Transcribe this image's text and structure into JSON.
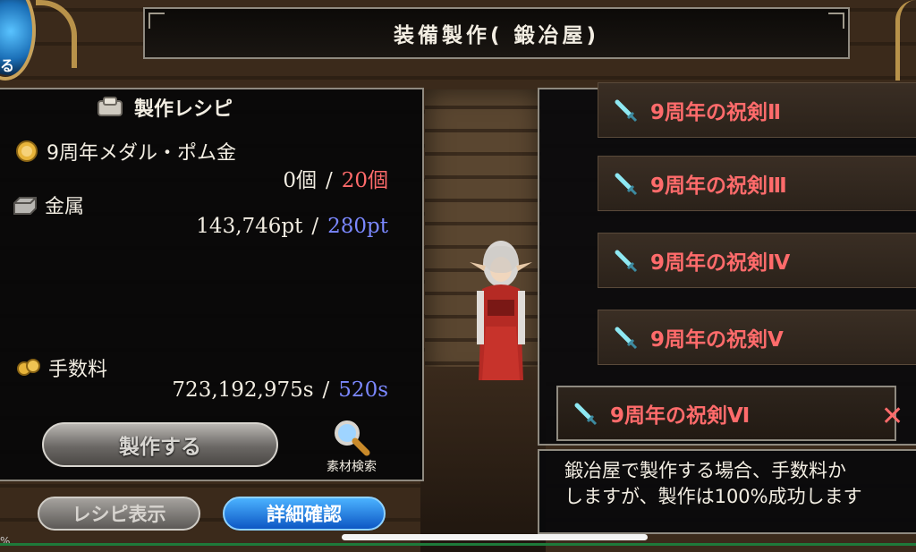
{
  "header": {
    "title": "装備製作( 鍛冶屋)"
  },
  "orb": {
    "text": "る"
  },
  "recipe": {
    "heading": "製作レシピ",
    "materials": [
      {
        "name": "9周年メダル・ポム金",
        "have": "0個",
        "need": "20個",
        "icon": "medal-icon"
      },
      {
        "name": "金属",
        "have": "143,746pt",
        "need": "280pt",
        "icon": "metal-ingot-icon"
      }
    ],
    "fee": {
      "label": "手数料",
      "have": "723,192,975s",
      "need": "520s",
      "icon": "coins-icon"
    },
    "separator": "/"
  },
  "buttons": {
    "make": "製作する",
    "search": "素材検索",
    "recipe_view": "レシピ表示",
    "details": "詳細確認"
  },
  "list": {
    "items": [
      {
        "label": "9周年の祝剣Ⅱ"
      },
      {
        "label": "9周年の祝剣Ⅲ"
      },
      {
        "label": "9周年の祝剣Ⅳ"
      },
      {
        "label": "9周年の祝剣Ⅴ"
      },
      {
        "label": "9周年の祝剣Ⅵ"
      }
    ],
    "close": "✕"
  },
  "description": {
    "line1": "鍛冶屋で製作する場合、手数料か",
    "line2": "しますが、製作は100%成功します"
  },
  "status": {
    "percent": "%"
  },
  "colors": {
    "accent_red": "#ff6b6b",
    "accent_blue": "#7b88ff",
    "frame": "#8f8a80"
  }
}
